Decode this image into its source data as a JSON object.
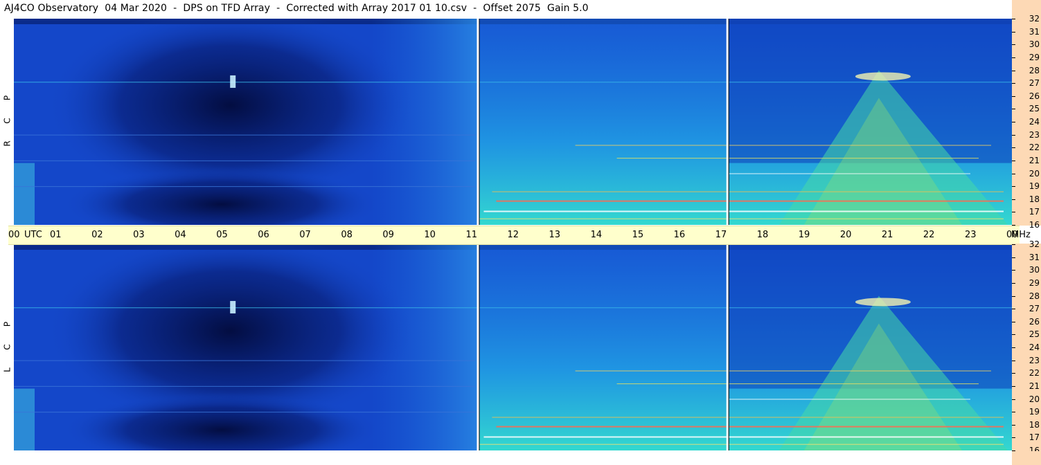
{
  "title": "AJ4CO Observatory  04 Mar 2020  -  DPS on TFD Array  -  Corrected with Array 2017 01 10.csv  -  Offset 2075  Gain 5.0",
  "panels": {
    "top_label": [
      "R",
      "C",
      "P"
    ],
    "bottom_label": [
      "L",
      "C",
      "P"
    ]
  },
  "time_axis": {
    "labels": [
      "00",
      "UTC",
      "01",
      "02",
      "03",
      "04",
      "05",
      "06",
      "07",
      "08",
      "09",
      "10",
      "11",
      "12",
      "13",
      "14",
      "15",
      "16",
      "17",
      "18",
      "19",
      "20",
      "21",
      "22",
      "23",
      "00",
      "MHz"
    ]
  },
  "freq_axis": {
    "labels": [
      "32",
      "31",
      "30",
      "29",
      "28",
      "27",
      "26",
      "25",
      "24",
      "23",
      "22",
      "21",
      "20",
      "19",
      "18",
      "17",
      "16"
    ]
  },
  "colors": {
    "background_blue": "#1447c9",
    "dark": "#020a3a",
    "bright": "#35e0d0",
    "axis_bg": "#ffffcc",
    "mhz_bg": "#fdd9b5"
  },
  "chart_data": {
    "type": "heatmap",
    "title": "AJ4CO Observatory  04 Mar 2020  -  DPS on TFD Array  -  Corrected with Array 2017 01 10.csv  -  Offset 2075  Gain 5.0",
    "x": {
      "unit": "UTC",
      "range": [
        0,
        24
      ],
      "ticks": [
        "00",
        "01",
        "02",
        "03",
        "04",
        "05",
        "06",
        "07",
        "08",
        "09",
        "10",
        "11",
        "12",
        "13",
        "14",
        "15",
        "16",
        "17",
        "18",
        "19",
        "20",
        "21",
        "22",
        "23",
        "00"
      ]
    },
    "y": {
      "unit": "MHz",
      "range": [
        16,
        32
      ],
      "ticks": [
        32,
        31,
        30,
        29,
        28,
        27,
        26,
        25,
        24,
        23,
        22,
        21,
        20,
        19,
        18,
        17,
        16
      ]
    },
    "panels": [
      "R C P",
      "L C P"
    ],
    "data_gaps_utc": [
      11.15,
      17.15
    ],
    "features": [
      {
        "name": "nighttime_quiet",
        "utc_range": [
          2.0,
          9.0
        ],
        "level": "low"
      },
      {
        "name": "daytime_noise",
        "utc_range": [
          11.2,
          23.5
        ],
        "level": "high"
      },
      {
        "name": "cosmic_source_arc",
        "utc_range": [
          18.5,
          24.0
        ],
        "mhz_range": [
          16,
          28
        ],
        "level": "high"
      }
    ]
  }
}
